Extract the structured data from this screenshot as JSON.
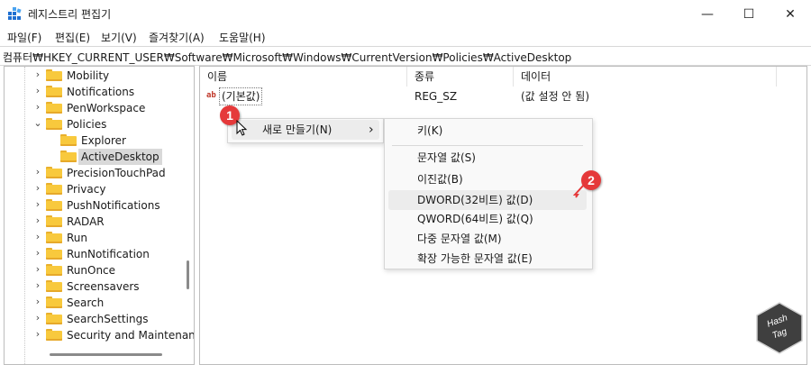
{
  "window": {
    "title": "레지스트리 편집기",
    "minimize_glyph": "—",
    "maximize_glyph": "☐",
    "close_glyph": "✕"
  },
  "menu": [
    "파일(F)",
    "편집(E)",
    "보기(V)",
    "즐겨찾기(A)",
    "도움말(H)"
  ],
  "address": "컴퓨터₩HKEY_CURRENT_USER₩Software₩Microsoft₩Windows₩CurrentVersion₩Policies₩ActiveDesktop",
  "tree": [
    {
      "label": "Mobility",
      "expand": "collapsed"
    },
    {
      "label": "Notifications",
      "expand": "collapsed"
    },
    {
      "label": "PenWorkspace",
      "expand": "collapsed"
    },
    {
      "label": "Policies",
      "expand": "expanded"
    },
    {
      "label": "Explorer",
      "expand": "none"
    },
    {
      "label": "ActiveDesktop",
      "expand": "none",
      "selected": true
    },
    {
      "label": "PrecisionTouchPad",
      "expand": "collapsed"
    },
    {
      "label": "Privacy",
      "expand": "collapsed"
    },
    {
      "label": "PushNotifications",
      "expand": "collapsed"
    },
    {
      "label": "RADAR",
      "expand": "collapsed"
    },
    {
      "label": "Run",
      "expand": "collapsed"
    },
    {
      "label": "RunNotification",
      "expand": "collapsed"
    },
    {
      "label": "RunOnce",
      "expand": "collapsed"
    },
    {
      "label": "Screensavers",
      "expand": "collapsed"
    },
    {
      "label": "Search",
      "expand": "collapsed"
    },
    {
      "label": "SearchSettings",
      "expand": "collapsed"
    },
    {
      "label": "Security and Maintenan",
      "expand": "collapsed"
    }
  ],
  "columns": {
    "name": "이름",
    "type": "종류",
    "data": "데이터"
  },
  "values": [
    {
      "name": "(기본값)",
      "type": "REG_SZ",
      "data": "(값 설정 안 됨)",
      "icon_text": "ab"
    }
  ],
  "context_menu": {
    "label": "새로 만들기(N)",
    "arrow": "›"
  },
  "submenu": {
    "key": "키(K)",
    "items": [
      "문자열 값(S)",
      "이진값(B)",
      "DWORD(32비트) 값(D)",
      "QWORD(64비트) 값(Q)",
      "다중 문자열 값(M)",
      "확장 가능한 문자열 값(E)"
    ],
    "highlighted": "DWORD(32비트) 값(D)"
  },
  "badges": [
    "1",
    "2"
  ],
  "watermark": {
    "line1": "Hash",
    "line2": "Tag"
  },
  "colors": {
    "folder": "#f8c93d",
    "badge": "#e5393a",
    "highlight": "#ececec",
    "watermark": "#3f3f3f"
  }
}
